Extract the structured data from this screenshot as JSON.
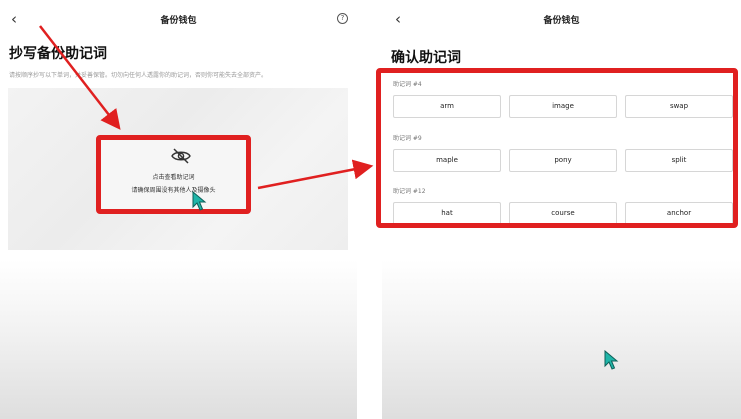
{
  "left": {
    "back_icon": "chevron-left-icon",
    "title": "备份钱包",
    "help_icon": "question-circle-icon",
    "heading": "抄写备份助记词",
    "description": "请按顺序抄写以下单词，并妥善保管。切勿向任何人透露你的助记词，否则你可能失去全部资产。",
    "reveal": {
      "icon": "eye-slash-icon",
      "line1": "点击查看助记词",
      "line2": "请确保周围没有其他人及摄像头"
    }
  },
  "right": {
    "back_icon": "chevron-left-icon",
    "title": "备份钱包",
    "heading": "确认助记词",
    "groups": [
      {
        "label": "助记词 #4",
        "options": [
          "arm",
          "image",
          "swap"
        ]
      },
      {
        "label": "助记词 #9",
        "options": [
          "maple",
          "pony",
          "split"
        ]
      },
      {
        "label": "助记词 #12",
        "options": [
          "hat",
          "course",
          "anchor"
        ]
      }
    ]
  },
  "colors": {
    "annotation_red": "#e02020",
    "cursor_teal": "#1fb5a8"
  }
}
